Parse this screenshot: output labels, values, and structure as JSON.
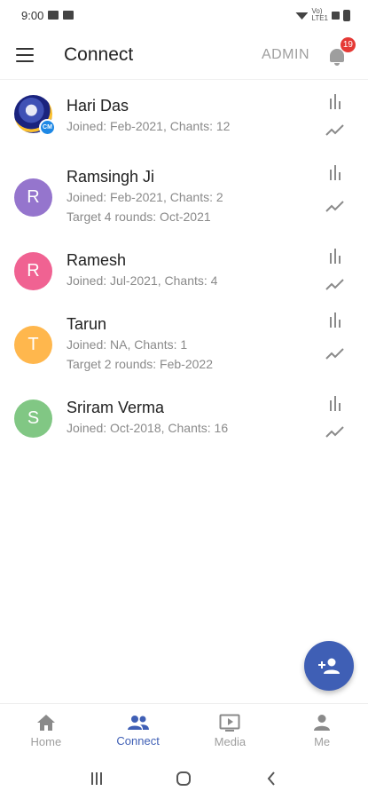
{
  "status_bar": {
    "time": "9:00",
    "signal_text_top": "Vo)",
    "signal_text_bottom": "LTE1"
  },
  "app_bar": {
    "title": "Connect",
    "admin_label": "ADMIN",
    "notification_count": "19"
  },
  "members": [
    {
      "name": "Hari Das",
      "avatar_type": "photo",
      "avatar_badge": "CM",
      "lines": [
        "Joined: Feb-2021, Chants: 12"
      ]
    },
    {
      "name": "Ramsingh Ji",
      "initial": "R",
      "color": "#9575cd",
      "lines": [
        "Joined: Feb-2021, Chants: 2",
        "Target 4 rounds: Oct-2021"
      ]
    },
    {
      "name": "Ramesh",
      "initial": "R",
      "color": "#f06292",
      "lines": [
        "Joined: Jul-2021, Chants: 4"
      ]
    },
    {
      "name": "Tarun",
      "initial": "T",
      "color": "#ffb74d",
      "lines": [
        "Joined: NA, Chants: 1",
        "Target 2 rounds: Feb-2022"
      ]
    },
    {
      "name": "Sriram Verma",
      "initial": "S",
      "color": "#81c784",
      "lines": [
        "Joined: Oct-2018, Chants: 16"
      ]
    }
  ],
  "fab": {
    "icon": "add-person-icon",
    "color": "#3f5fb5"
  },
  "bottom_nav": [
    {
      "label": "Home",
      "icon": "home-icon",
      "active": false
    },
    {
      "label": "Connect",
      "icon": "people-icon",
      "active": true
    },
    {
      "label": "Media",
      "icon": "media-icon",
      "active": false
    },
    {
      "label": "Me",
      "icon": "person-icon",
      "active": false
    }
  ],
  "colors": {
    "accent": "#3f5fb5",
    "badge": "#e53935"
  }
}
